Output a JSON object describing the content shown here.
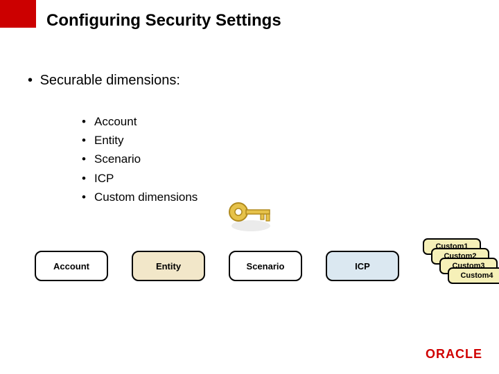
{
  "title": "Configuring Security Settings",
  "l1_bullet": "Securable dimensions:",
  "sub_bullets": [
    "Account",
    "Entity",
    "Scenario",
    "ICP",
    "Custom dimensions"
  ],
  "boxes": {
    "account": "Account",
    "entity": "Entity",
    "scenario": "Scenario",
    "icp": "ICP"
  },
  "custom": [
    "Custom1",
    "Custom2",
    "Custom3",
    "Custom4"
  ],
  "logo_text": "ORACLE"
}
